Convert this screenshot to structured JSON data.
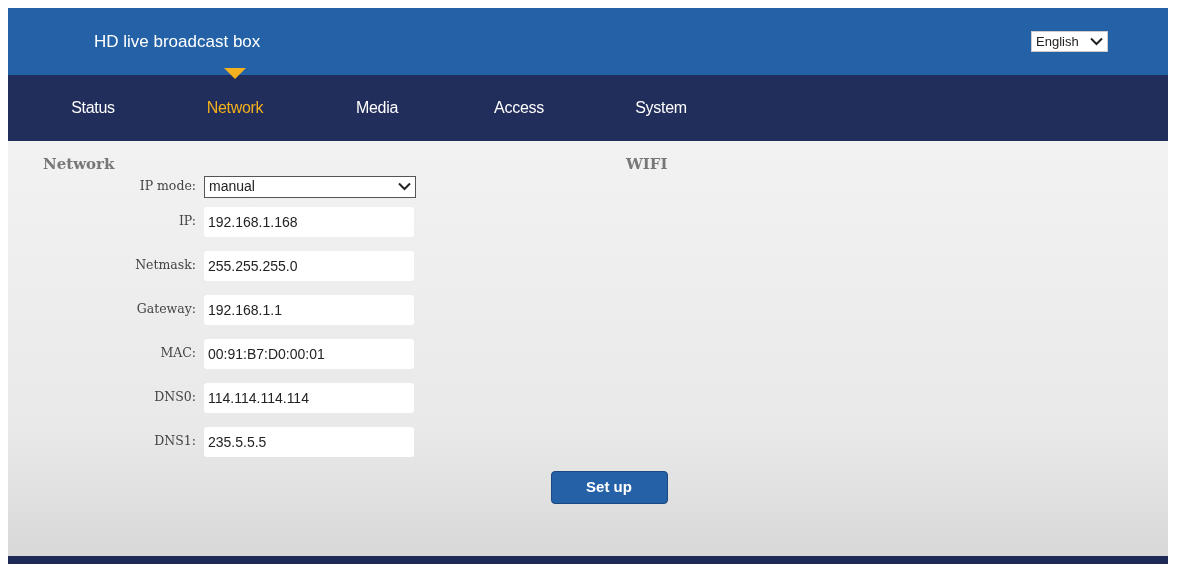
{
  "header": {
    "title": "HD live broadcast box",
    "language": "English"
  },
  "nav": [
    {
      "label": "Status",
      "selected": false
    },
    {
      "label": "Network",
      "selected": true
    },
    {
      "label": "Media",
      "selected": false
    },
    {
      "label": "Access",
      "selected": false
    },
    {
      "label": "System",
      "selected": false
    }
  ],
  "network": {
    "heading": "Network",
    "fields": [
      {
        "kind": "select",
        "label": "IP mode:",
        "value": "manual"
      },
      {
        "kind": "text",
        "label": "IP:",
        "value": "192.168.1.168"
      },
      {
        "kind": "text",
        "label": "Netmask:",
        "value": "255.255.255.0"
      },
      {
        "kind": "text",
        "label": "Gateway:",
        "value": "192.168.1.1"
      },
      {
        "kind": "text",
        "label": "MAC:",
        "value": "00:91:B7:D0:00:01"
      },
      {
        "kind": "text",
        "label": "DNS0:",
        "value": "114.114.114.114"
      },
      {
        "kind": "text",
        "label": "DNS1:",
        "value": "235.5.5.5"
      }
    ]
  },
  "wifi": {
    "heading": "WIFI"
  },
  "submit": "Set up"
}
